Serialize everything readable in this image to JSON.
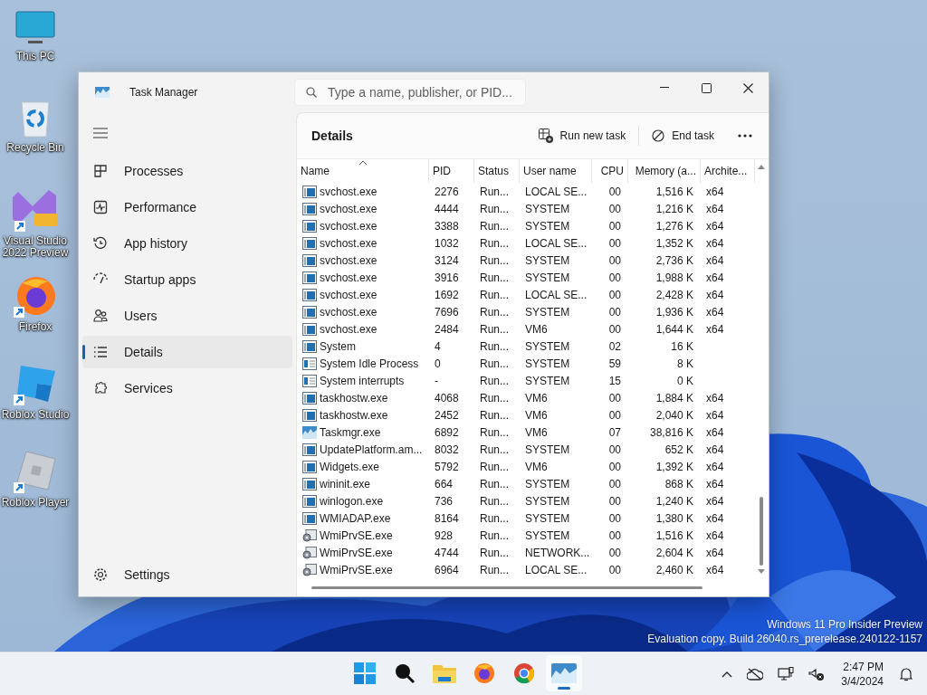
{
  "desktop_icons": [
    {
      "label": "This PC"
    },
    {
      "label": "Recycle Bin"
    },
    {
      "label": "Visual Studio 2022 Preview"
    },
    {
      "label": "Firefox"
    },
    {
      "label": "Roblox Studio"
    },
    {
      "label": "Roblox Player"
    }
  ],
  "window": {
    "title": "Task Manager",
    "search": {
      "placeholder": "Type a name, publisher, or PID..."
    }
  },
  "sidebar": {
    "items": [
      {
        "label": "Processes",
        "selected": false
      },
      {
        "label": "Performance",
        "selected": false
      },
      {
        "label": "App history",
        "selected": false
      },
      {
        "label": "Startup apps",
        "selected": false
      },
      {
        "label": "Users",
        "selected": false
      },
      {
        "label": "Details",
        "selected": true
      },
      {
        "label": "Services",
        "selected": false
      }
    ],
    "settings": "Settings"
  },
  "details": {
    "title": "Details",
    "actions": [
      "Run new task",
      "End task"
    ],
    "table": {
      "columns": [
        {
          "label": "Name",
          "sorted": true
        },
        {
          "label": "PID",
          "sorted": false
        },
        {
          "label": "Status",
          "sorted": false
        },
        {
          "label": "User name",
          "sorted": false
        },
        {
          "label": "CPU",
          "sorted": false
        },
        {
          "label": "Memory (a...",
          "sorted": false
        },
        {
          "label": "Archite...",
          "sorted": false
        }
      ],
      "rows": [
        {
          "kind": "service",
          "name": "svchost.exe",
          "pid": "2276",
          "status": "Run...",
          "user": "LOCAL SE...",
          "cpu": "00",
          "memory": "1,516 K",
          "arch": "x64"
        },
        {
          "kind": "service",
          "name": "svchost.exe",
          "pid": "4444",
          "status": "Run...",
          "user": "SYSTEM",
          "cpu": "00",
          "memory": "1,216 K",
          "arch": "x64"
        },
        {
          "kind": "service",
          "name": "svchost.exe",
          "pid": "3388",
          "status": "Run...",
          "user": "SYSTEM",
          "cpu": "00",
          "memory": "1,276 K",
          "arch": "x64"
        },
        {
          "kind": "service",
          "name": "svchost.exe",
          "pid": "1032",
          "status": "Run...",
          "user": "LOCAL SE...",
          "cpu": "00",
          "memory": "1,352 K",
          "arch": "x64"
        },
        {
          "kind": "service",
          "name": "svchost.exe",
          "pid": "3124",
          "status": "Run...",
          "user": "SYSTEM",
          "cpu": "00",
          "memory": "2,736 K",
          "arch": "x64"
        },
        {
          "kind": "service",
          "name": "svchost.exe",
          "pid": "3916",
          "status": "Run...",
          "user": "SYSTEM",
          "cpu": "00",
          "memory": "1,988 K",
          "arch": "x64"
        },
        {
          "kind": "service",
          "name": "svchost.exe",
          "pid": "1692",
          "status": "Run...",
          "user": "LOCAL SE...",
          "cpu": "00",
          "memory": "2,428 K",
          "arch": "x64"
        },
        {
          "kind": "service",
          "name": "svchost.exe",
          "pid": "7696",
          "status": "Run...",
          "user": "SYSTEM",
          "cpu": "00",
          "memory": "1,936 K",
          "arch": "x64"
        },
        {
          "kind": "service",
          "name": "svchost.exe",
          "pid": "2484",
          "status": "Run...",
          "user": "VM6",
          "cpu": "00",
          "memory": "1,644 K",
          "arch": "x64"
        },
        {
          "kind": "service",
          "name": "System",
          "pid": "4",
          "status": "Run...",
          "user": "SYSTEM",
          "cpu": "02",
          "memory": "16 K"
        },
        {
          "kind": "list",
          "name": "System Idle Process",
          "pid": "0",
          "status": "Run...",
          "user": "SYSTEM",
          "cpu": "59",
          "memory": "8 K"
        },
        {
          "kind": "list",
          "name": "System interrupts",
          "pid": "-",
          "status": "Run...",
          "user": "SYSTEM",
          "cpu": "15",
          "memory": "0 K"
        },
        {
          "kind": "service",
          "name": "taskhostw.exe",
          "pid": "4068",
          "status": "Run...",
          "user": "VM6",
          "cpu": "00",
          "memory": "1,884 K",
          "arch": "x64"
        },
        {
          "kind": "service",
          "name": "taskhostw.exe",
          "pid": "2452",
          "status": "Run...",
          "user": "VM6",
          "cpu": "00",
          "memory": "2,040 K",
          "arch": "x64"
        },
        {
          "kind": "taskmgr",
          "name": "Taskmgr.exe",
          "pid": "6892",
          "status": "Run...",
          "user": "VM6",
          "cpu": "07",
          "memory": "38,816 K",
          "arch": "x64"
        },
        {
          "kind": "service",
          "name": "UpdatePlatform.am...",
          "pid": "8032",
          "status": "Run...",
          "user": "SYSTEM",
          "cpu": "00",
          "memory": "652 K",
          "arch": "x64"
        },
        {
          "kind": "service",
          "name": "Widgets.exe",
          "pid": "5792",
          "status": "Run...",
          "user": "VM6",
          "cpu": "00",
          "memory": "1,392 K",
          "arch": "x64"
        },
        {
          "kind": "service",
          "name": "wininit.exe",
          "pid": "664",
          "status": "Run...",
          "user": "SYSTEM",
          "cpu": "00",
          "memory": "868 K",
          "arch": "x64"
        },
        {
          "kind": "service",
          "name": "winlogon.exe",
          "pid": "736",
          "status": "Run...",
          "user": "SYSTEM",
          "cpu": "00",
          "memory": "1,240 K",
          "arch": "x64"
        },
        {
          "kind": "service",
          "name": "WMIADAP.exe",
          "pid": "8164",
          "status": "Run...",
          "user": "SYSTEM",
          "cpu": "00",
          "memory": "1,380 K",
          "arch": "x64"
        },
        {
          "kind": "wmi",
          "name": "WmiPrvSE.exe",
          "pid": "928",
          "status": "Run...",
          "user": "SYSTEM",
          "cpu": "00",
          "memory": "1,516 K",
          "arch": "x64"
        },
        {
          "kind": "wmi",
          "name": "WmiPrvSE.exe",
          "pid": "4744",
          "status": "Run...",
          "user": "NETWORK...",
          "cpu": "00",
          "memory": "2,604 K",
          "arch": "x64"
        },
        {
          "kind": "wmi",
          "name": "WmiPrvSE.exe",
          "pid": "6964",
          "status": "Run...",
          "user": "LOCAL SE...",
          "cpu": "00",
          "memory": "2,460 K",
          "arch": "x64"
        }
      ]
    }
  },
  "watermark": [
    "Windows 11 Pro Insider Preview",
    "Evaluation copy. Build 26040.rs_prerelease.240122-1157"
  ],
  "taskbar": {
    "apps": [
      {
        "selected": false
      },
      {
        "selected": false
      },
      {
        "selected": false
      },
      {
        "selected": false
      },
      {
        "selected": false
      },
      {
        "selected": true
      }
    ],
    "clock": {
      "time": "2:47 PM",
      "date": "3/4/2024"
    }
  }
}
